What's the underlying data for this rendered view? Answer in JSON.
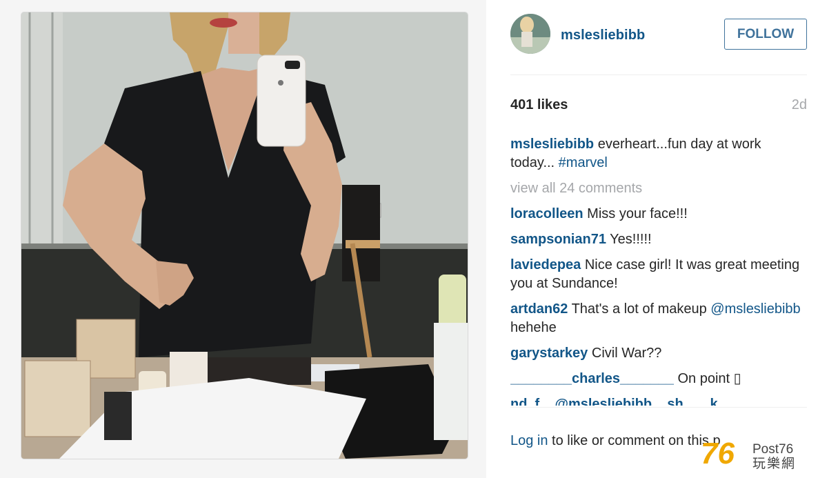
{
  "post": {
    "username": "mslesliebibb",
    "follow_label": "FOLLOW",
    "likes": "401 likes",
    "time_ago": "2d"
  },
  "caption": {
    "user": "mslesliebibb",
    "text": "everheart...fun day at work today... ",
    "hashtag": "#marvel"
  },
  "view_all": "view all 24 comments",
  "comments": [
    {
      "user": "loracolleen",
      "text": "Miss your face!!!"
    },
    {
      "user": "sampsonian71",
      "text": "Yes!!!!!"
    },
    {
      "user": "laviedepea",
      "text": "Nice case girl! It was great meeting you at Sundance!"
    },
    {
      "user": "artdan62",
      "text": "That's a lot of makeup ",
      "mention": "@mslesliebibb",
      "after": " hehehe"
    },
    {
      "user": "garystarkey",
      "text": "Civil War??"
    },
    {
      "user": "________charles_______",
      "text": "On point ▯"
    }
  ],
  "partial_comment": "nd_f... @mslesliebibb ...sh... ...k...",
  "footer": {
    "login": "Log in",
    "rest": " to like or comment on this p"
  },
  "watermark": {
    "number": "76",
    "brand": "Post76",
    "cn": "玩樂網"
  },
  "colors": {
    "link": "#125688",
    "follow": "#3f729b",
    "muted": "#a5a7aa"
  }
}
